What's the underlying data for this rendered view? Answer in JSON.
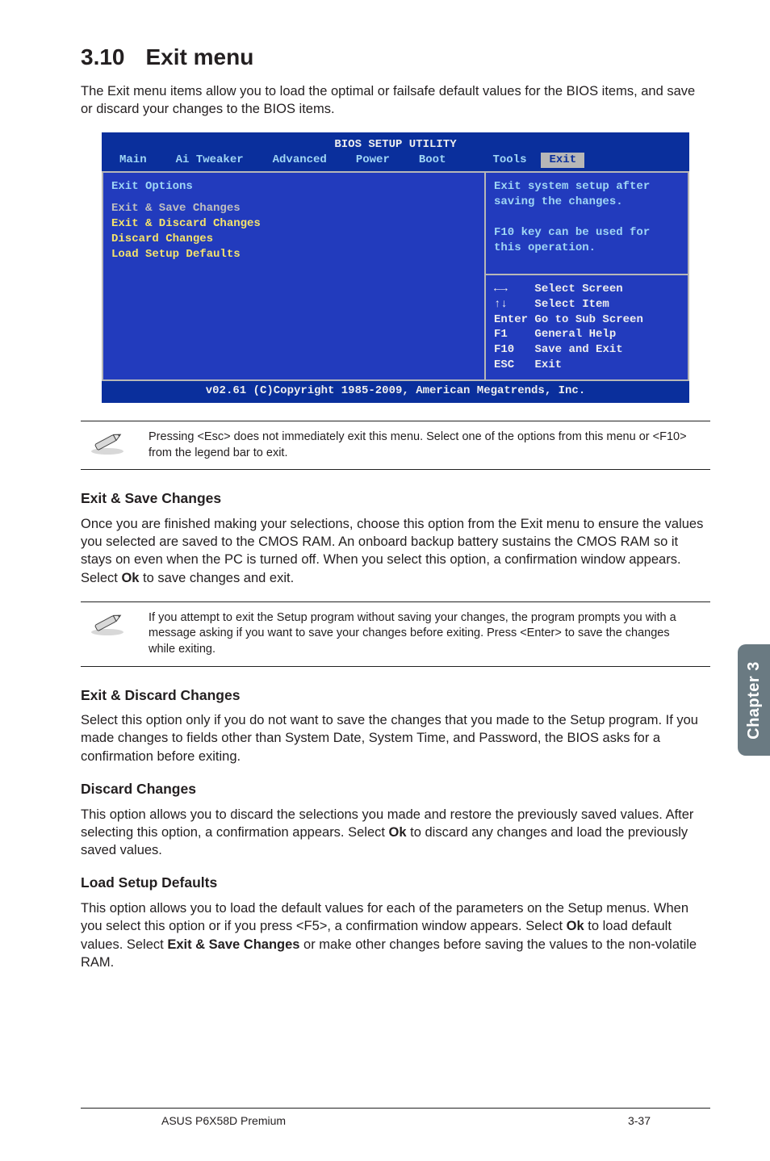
{
  "section": {
    "number": "3.10",
    "title": "Exit menu"
  },
  "intro": "The Exit menu items allow you to load the optimal or failsafe default values for the BIOS items, and save or discard your changes to the BIOS items.",
  "bios": {
    "title": "BIOS SETUP UTILITY",
    "tabs": [
      "Main",
      "Ai Tweaker",
      "Advanced",
      "Power",
      "Boot",
      "Tools",
      "Exit"
    ],
    "active_tab": "Exit",
    "left": {
      "heading": "Exit Options",
      "items": [
        "Exit & Save Changes",
        "Exit & Discard Changes",
        "Discard Changes",
        "",
        "Load Setup Defaults"
      ]
    },
    "right_top": "Exit system setup after saving the changes.\n\nF10 key can be used for this operation.",
    "right_bottom": [
      {
        "key": "←→",
        "label": "Select Screen"
      },
      {
        "key": "↑↓",
        "label": "Select Item"
      },
      {
        "key": "Enter",
        "label": "Go to Sub Screen"
      },
      {
        "key": "F1",
        "label": "General Help"
      },
      {
        "key": "F10",
        "label": "Save and Exit"
      },
      {
        "key": "ESC",
        "label": "Exit"
      }
    ],
    "footer": "v02.61 (C)Copyright 1985-2009, American Megatrends, Inc."
  },
  "note1": "Pressing <Esc> does not immediately exit this menu. Select one of the options from this menu or <F10> from the legend bar to exit.",
  "sub1": {
    "heading": "Exit & Save Changes",
    "text_pre": "Once you are finished making your selections, choose this option from the Exit menu to ensure the values you selected are saved to the CMOS RAM. An onboard backup battery sustains the CMOS RAM so it stays on even when the PC is turned off. When you select this option, a confirmation window appears. Select ",
    "bold1": "Ok",
    "text_post": " to save changes and exit."
  },
  "note2": "If you attempt to exit the Setup program without saving your changes, the program prompts you with a message asking if you want to save your changes before exiting. Press <Enter> to save the changes while exiting.",
  "sub2": {
    "heading": "Exit & Discard Changes",
    "text": "Select this option only if you do not want to save the changes that you  made to the Setup program. If you made changes to fields other than System Date, System Time, and Password, the BIOS asks for a confirmation before exiting."
  },
  "sub3": {
    "heading": "Discard Changes",
    "text_pre": "This option allows you to discard the selections you made and restore the previously saved values. After selecting this option, a confirmation appears. Select ",
    "bold1": "Ok",
    "text_post": " to discard any changes and load the previously saved values."
  },
  "sub4": {
    "heading": "Load Setup Defaults",
    "text_pre": "This option allows you to load the default values for each of the parameters on the Setup menus. When you select this option or if you press <F5>, a confirmation window appears. Select ",
    "bold1": "Ok",
    "text_mid": " to load default values. Select ",
    "bold2": "Exit & Save Changes",
    "text_post": " or make other changes before saving the values to the non-volatile RAM."
  },
  "sidetab": "Chapter 3",
  "footer": {
    "left": "ASUS P6X58D Premium",
    "right": "3-37"
  }
}
